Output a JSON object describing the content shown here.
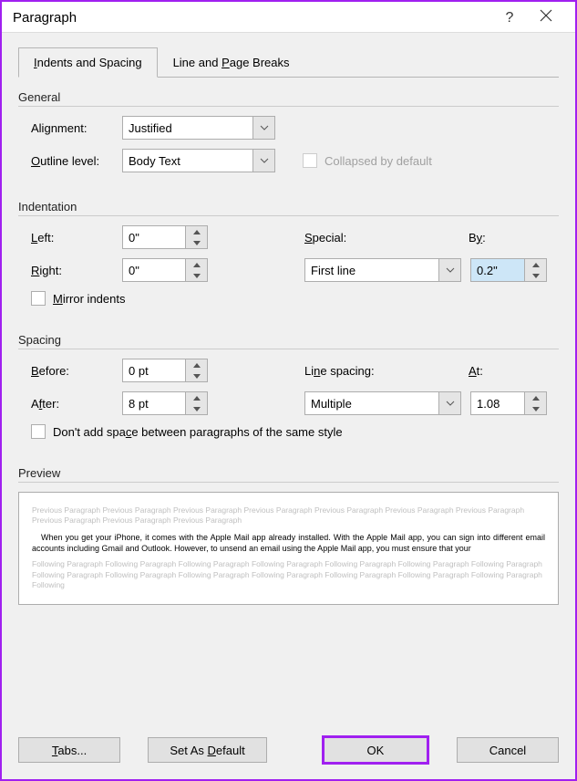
{
  "title": "Paragraph",
  "tabs": {
    "indents": "Indents and Spacing",
    "breaks": "Line and Page Breaks"
  },
  "general": {
    "title": "General",
    "alignment_label": "Alignment:",
    "alignment_value": "Justified",
    "outline_label": "Outline level:",
    "outline_value": "Body Text",
    "collapsed_label": "Collapsed by default"
  },
  "indentation": {
    "title": "Indentation",
    "left_label": "Left:",
    "left_value": "0\"",
    "right_label": "Right:",
    "right_value": "0\"",
    "special_label": "Special:",
    "special_value": "First line",
    "by_label": "By:",
    "by_value": "0.2\"",
    "mirror_label": "Mirror indents"
  },
  "spacing": {
    "title": "Spacing",
    "before_label": "Before:",
    "before_value": "0 pt",
    "after_label": "After:",
    "after_value": "8 pt",
    "line_label": "Line spacing:",
    "line_value": "Multiple",
    "at_label": "At:",
    "at_value": "1.08",
    "noadd_label": "Don't add space between paragraphs of the same style"
  },
  "preview": {
    "title": "Preview",
    "prev_text": "Previous Paragraph Previous Paragraph Previous Paragraph Previous Paragraph Previous Paragraph Previous Paragraph Previous Paragraph Previous Paragraph Previous Paragraph Previous Paragraph",
    "sample_text": "When you get your iPhone, it comes with the Apple Mail app already installed. With the Apple Mail app, you can sign into different email accounts including Gmail and Outlook. However, to unsend an email using the Apple Mail app, you must ensure that your",
    "foll_text": "Following Paragraph Following Paragraph Following Paragraph Following Paragraph Following Paragraph Following Paragraph Following Paragraph Following Paragraph Following Paragraph Following Paragraph Following Paragraph Following Paragraph Following Paragraph Following Paragraph Following"
  },
  "buttons": {
    "tabs": "Tabs...",
    "default": "Set As Default",
    "ok": "OK",
    "cancel": "Cancel"
  }
}
